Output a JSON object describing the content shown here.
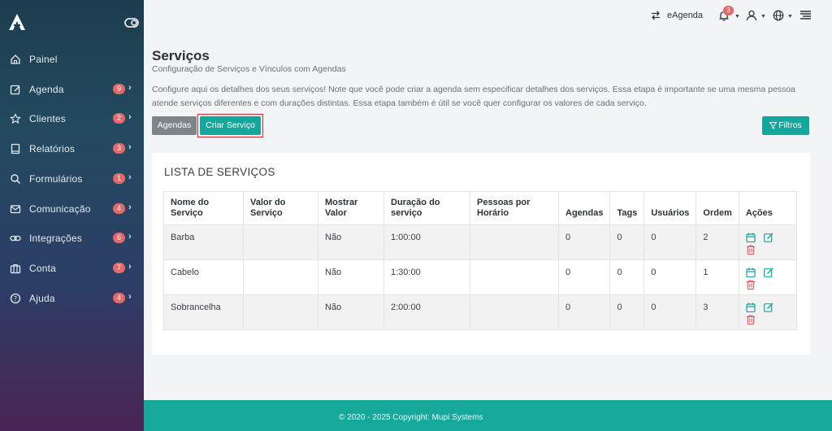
{
  "sidebar": {
    "items": [
      {
        "label": "Painel",
        "icon": "home-icon",
        "badge": null
      },
      {
        "label": "Agenda",
        "icon": "edit-icon",
        "badge": "9"
      },
      {
        "label": "Clientes",
        "icon": "star-icon",
        "badge": "2"
      },
      {
        "label": "Relatórios",
        "icon": "book-icon",
        "badge": "3"
      },
      {
        "label": "Formulários",
        "icon": "search-icon",
        "badge": "1"
      },
      {
        "label": "Comunicação",
        "icon": "mail-icon",
        "badge": "4"
      },
      {
        "label": "Integrações",
        "icon": "link-icon",
        "badge": "6"
      },
      {
        "label": "Conta",
        "icon": "briefcase-icon",
        "badge": "7"
      },
      {
        "label": "Ajuda",
        "icon": "help-icon",
        "badge": "4"
      }
    ]
  },
  "topbar": {
    "app_name": "eAgenda",
    "notifications_count": "3"
  },
  "header": {
    "title": "Serviços",
    "subtitle": "Configuração de Serviços e Vínculos com Agendas",
    "description": "Configure aqui os detalhes dos seus serviços! Note que você pode criar a agenda sem especificar detalhes dos serviços. Essa etapa é importante se uma mesma pessoa atende serviços diferentes e com durações distintas. Essa etapa também é útil se você quer configurar os valores de cada serviço."
  },
  "buttons": {
    "agendas": "Agendas",
    "criar": "Criar Serviço",
    "filtros": "Filtros"
  },
  "card": {
    "title": "LISTA DE SERVIÇOS",
    "columns": [
      "Nome do Serviço",
      "Valor do Serviço",
      "Mostrar Valor",
      "Duração do serviço",
      "Pessoas por Horário",
      "Agendas",
      "Tags",
      "Usuários",
      "Ordem",
      "Ações"
    ],
    "rows": [
      {
        "nome": "Barba",
        "valor": "",
        "mostrar": "Não",
        "duracao": "1:00:00",
        "pessoas": "",
        "agendas": "0",
        "tags": "0",
        "usuarios": "0",
        "ordem": "2"
      },
      {
        "nome": "Cabelo",
        "valor": "",
        "mostrar": "Não",
        "duracao": "1:30:00",
        "pessoas": "",
        "agendas": "0",
        "tags": "0",
        "usuarios": "0",
        "ordem": "1"
      },
      {
        "nome": "Sobrancelha",
        "valor": "",
        "mostrar": "Não",
        "duracao": "2:00:00",
        "pessoas": "",
        "agendas": "0",
        "tags": "0",
        "usuarios": "0",
        "ordem": "3"
      }
    ]
  },
  "footer": {
    "text": "© 2020 - 2025 Copyright: Mupi Systems"
  },
  "colors": {
    "accent": "#14a79b",
    "badge": "#e26a6a",
    "highlight_outline": "#d9262e",
    "secondary_button": "#7d848a"
  }
}
